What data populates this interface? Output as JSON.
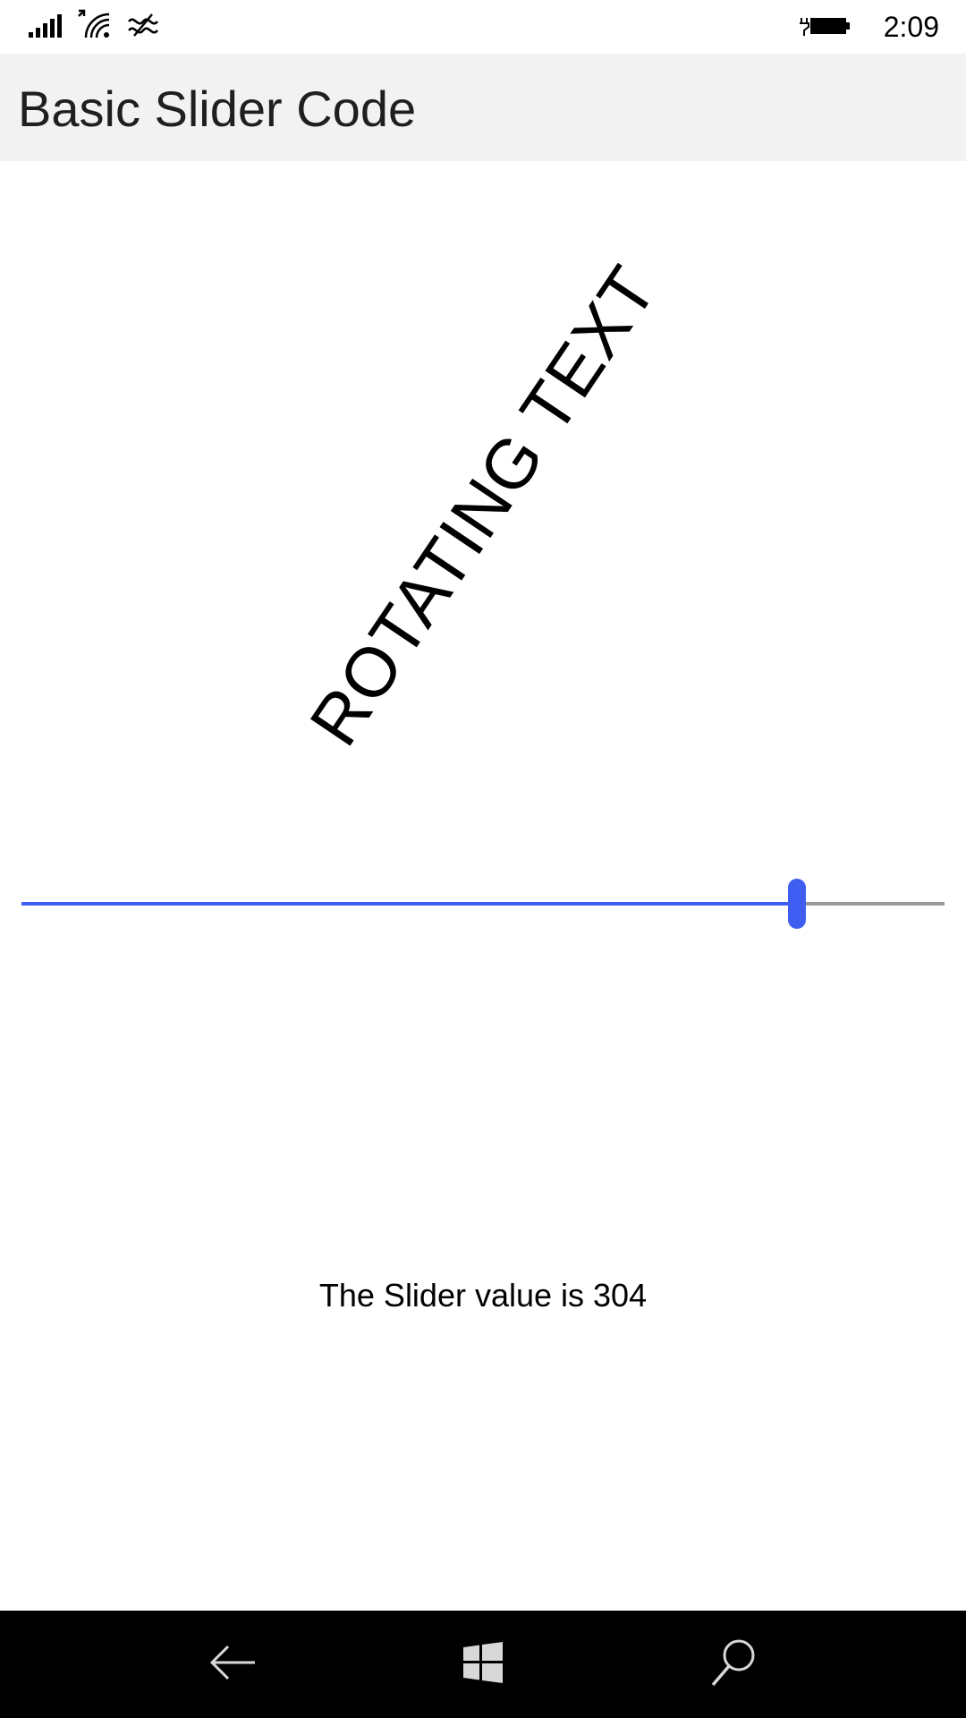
{
  "status_bar": {
    "time": "2:09",
    "icons": [
      "signal-icon",
      "wifi-icon",
      "connectivity-icon",
      "battery-icon"
    ]
  },
  "header": {
    "title": "Basic Slider Code"
  },
  "rotating_label": {
    "text": "ROTATING TEXT"
  },
  "slider": {
    "value": 304,
    "fill_fraction": 0.84,
    "accent_color": "#3d5ef0",
    "track_color": "#9a9a9a"
  },
  "value_text": "The Slider value is 304",
  "nav_bar": {
    "icons": [
      "back-icon",
      "windows-icon",
      "search-icon"
    ]
  }
}
